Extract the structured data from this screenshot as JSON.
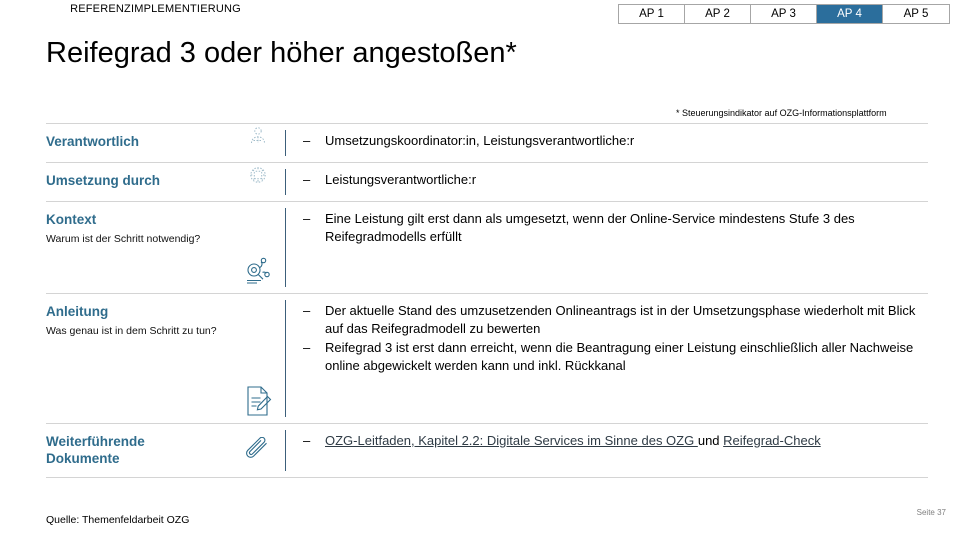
{
  "header": {
    "eyebrow": "REFERENZIMPLEMENTIERUNG",
    "title": "Reifegrad 3 oder höher angestoßen*",
    "accent_color": "#2f6c8c",
    "active_tab_color": "#2b6e9c"
  },
  "tabs": [
    {
      "label": "AP 1",
      "active": false
    },
    {
      "label": "AP 2",
      "active": false
    },
    {
      "label": "AP 3",
      "active": false
    },
    {
      "label": "AP 4",
      "active": true
    },
    {
      "label": "AP 5",
      "active": false
    }
  ],
  "footnote": "* Steuerungsindikator auf OZG-Informationsplattform",
  "rows": [
    {
      "title": "Verantwortlich",
      "subtitle": "",
      "icon": "people-icon",
      "bullets": [
        {
          "text": "Umsetzungskoordinator:in, Leistungsverantwortliche:r"
        }
      ]
    },
    {
      "title": "Umsetzung durch",
      "subtitle": "",
      "icon": "gear-icon",
      "bullets": [
        {
          "text": "Leistungsverantwortliche:r"
        }
      ]
    },
    {
      "title": "Kontext",
      "subtitle": "Warum ist der Schritt notwendig?",
      "icon": "magnifier-insight-icon",
      "bullets": [
        {
          "text": "Eine Leistung gilt erst dann als umgesetzt, wenn der Online-Service mindestens Stufe 3 des Reifegradmodells erfüllt"
        }
      ]
    },
    {
      "title": "Anleitung",
      "subtitle": "Was genau ist in dem Schritt zu tun?",
      "icon": "document-pencil-icon",
      "bullets": [
        {
          "text": "Der aktuelle Stand des umzusetzenden Onlineantrags ist in der Umsetzungsphase wiederholt mit Blick auf das Reifegradmodell zu bewerten"
        },
        {
          "text": "Reifegrad 3 ist erst dann erreicht, wenn die Beantragung einer Leistung einschließlich aller Nachweise online abgewickelt werden kann und inkl. Rückkanal"
        }
      ]
    },
    {
      "title": "Weiterführende\nDokumente",
      "subtitle": "",
      "icon": "paperclip-icon",
      "bullets": [
        {
          "link_before": "OZG-Leitfaden, Kapitel 2.2: Digitale Services im Sinne des OZG ",
          "conjunction": " und ",
          "link_after": "Reifegrad-Check"
        }
      ]
    }
  ],
  "footer": {
    "source": "Quelle: Themenfeldarbeit OZG",
    "page": "Seite 37"
  }
}
